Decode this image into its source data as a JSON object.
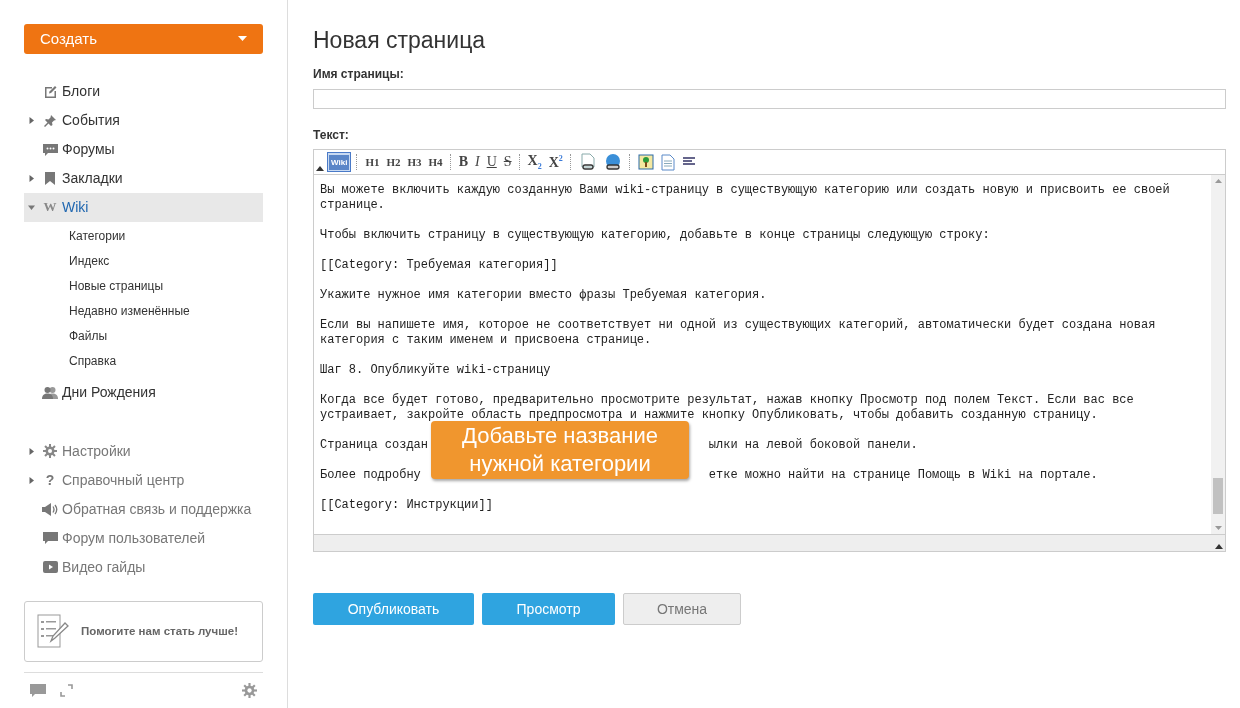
{
  "sidebar": {
    "create_button": "Создать",
    "nav": [
      {
        "label": "Блоги",
        "expandable": false,
        "expanded": false,
        "selected": false
      },
      {
        "label": "События",
        "expandable": true,
        "expanded": false,
        "selected": false
      },
      {
        "label": "Форумы",
        "expandable": false,
        "expanded": false,
        "selected": false
      },
      {
        "label": "Закладки",
        "expandable": true,
        "expanded": false,
        "selected": false
      },
      {
        "label": "Wiki",
        "icon_text": "W",
        "expandable": true,
        "expanded": true,
        "selected": true,
        "children": [
          {
            "label": "Категории"
          },
          {
            "label": "Индекс"
          },
          {
            "label": "Новые страницы"
          },
          {
            "label": "Недавно изменённые"
          },
          {
            "label": "Файлы"
          },
          {
            "label": "Справка"
          }
        ]
      },
      {
        "label": "Дни Рождения",
        "expandable": false,
        "expanded": false,
        "selected": false
      }
    ],
    "help_nav": [
      {
        "label": "Настройки",
        "expandable": true
      },
      {
        "label": "Справочный центр",
        "icon_text": "?",
        "expandable": true
      },
      {
        "label": "Обратная связь и поддержка",
        "expandable": false
      },
      {
        "label": "Форум пользователей",
        "expandable": false
      },
      {
        "label": "Видео гайды",
        "expandable": false
      }
    ],
    "feedback_card": "Помогите нам стать лучше!"
  },
  "page": {
    "title": "Новая страница",
    "name_label": "Имя страницы:",
    "text_label": "Текст:",
    "toolbar": [
      {
        "kind": "wiki",
        "label": "Wiki",
        "selected": true
      },
      {
        "kind": "sep"
      },
      {
        "kind": "text",
        "label": "H1"
      },
      {
        "kind": "text",
        "label": "H2"
      },
      {
        "kind": "text",
        "label": "H3"
      },
      {
        "kind": "text",
        "label": "H4"
      },
      {
        "kind": "sep"
      },
      {
        "kind": "bold",
        "label": "B"
      },
      {
        "kind": "italic",
        "label": "I"
      },
      {
        "kind": "underline",
        "label": "U"
      },
      {
        "kind": "strike",
        "label": "S"
      },
      {
        "kind": "sep"
      },
      {
        "kind": "sub",
        "label": "X",
        "sup": "2"
      },
      {
        "kind": "super",
        "label": "X",
        "sup": "2"
      },
      {
        "kind": "sep"
      },
      {
        "kind": "pagelink"
      },
      {
        "kind": "weblink"
      },
      {
        "kind": "sep"
      },
      {
        "kind": "image"
      },
      {
        "kind": "document"
      },
      {
        "kind": "rule"
      }
    ],
    "editor": [
      {
        "lines": [
          {
            "text": "Вы можете включить каждую созданную Вами wiki-страницу в существующую категорию или создать новую и присвоить ее своей"
          },
          {
            "text": "странице."
          }
        ]
      },
      {
        "lines": [
          {
            "text": "Чтобы включить страницу в существующую категорию, добавьте в конце страницы следующую строку:"
          }
        ]
      },
      {
        "lines": [
          {
            "text": "[[Category: Требуемая категория]]"
          }
        ]
      },
      {
        "lines": [
          {
            "text": "Укажите нужное имя категории вместо фразы Требуемая категория."
          }
        ]
      },
      {
        "lines": [
          {
            "text": "Если вы напишете имя, которое не соответствует ни одной из существующих категорий, автоматически будет создана новая"
          },
          {
            "text": "категория с таким именем и присвоена странице."
          }
        ]
      },
      {
        "lines": [
          {
            "text": "Шаг 8. Опубликуйте wiki-страницу"
          }
        ]
      },
      {
        "lines": [
          {
            "text": "Когда все будет готово, предварительно просмотрите результат, нажав кнопку Просмотр под полем Текст. Если вас все"
          },
          {
            "text": "устраивает, закройте область предпросмотра и нажмите кнопку Опубликовать, чтобы добавить созданную страницу."
          }
        ]
      },
      {
        "lines": [
          {
            "text": "Страница создан",
            "rest": "ылки на левой боковой панели."
          }
        ]
      },
      {
        "lines": [
          {
            "text": "Более подробну",
            "rest": "етке можно найти на странице Помощь в Wiki на портале."
          }
        ]
      },
      {
        "lines": [
          {
            "text": "[[Category: Инструкции]]"
          }
        ]
      }
    ],
    "callout": [
      "Добавьте название",
      "нужной категории"
    ],
    "buttons": [
      {
        "label": "Опубликовать",
        "kind": "primary"
      },
      {
        "label": "Просмотр",
        "kind": "primary"
      },
      {
        "label": "Отмена",
        "kind": "secondary"
      }
    ]
  }
}
